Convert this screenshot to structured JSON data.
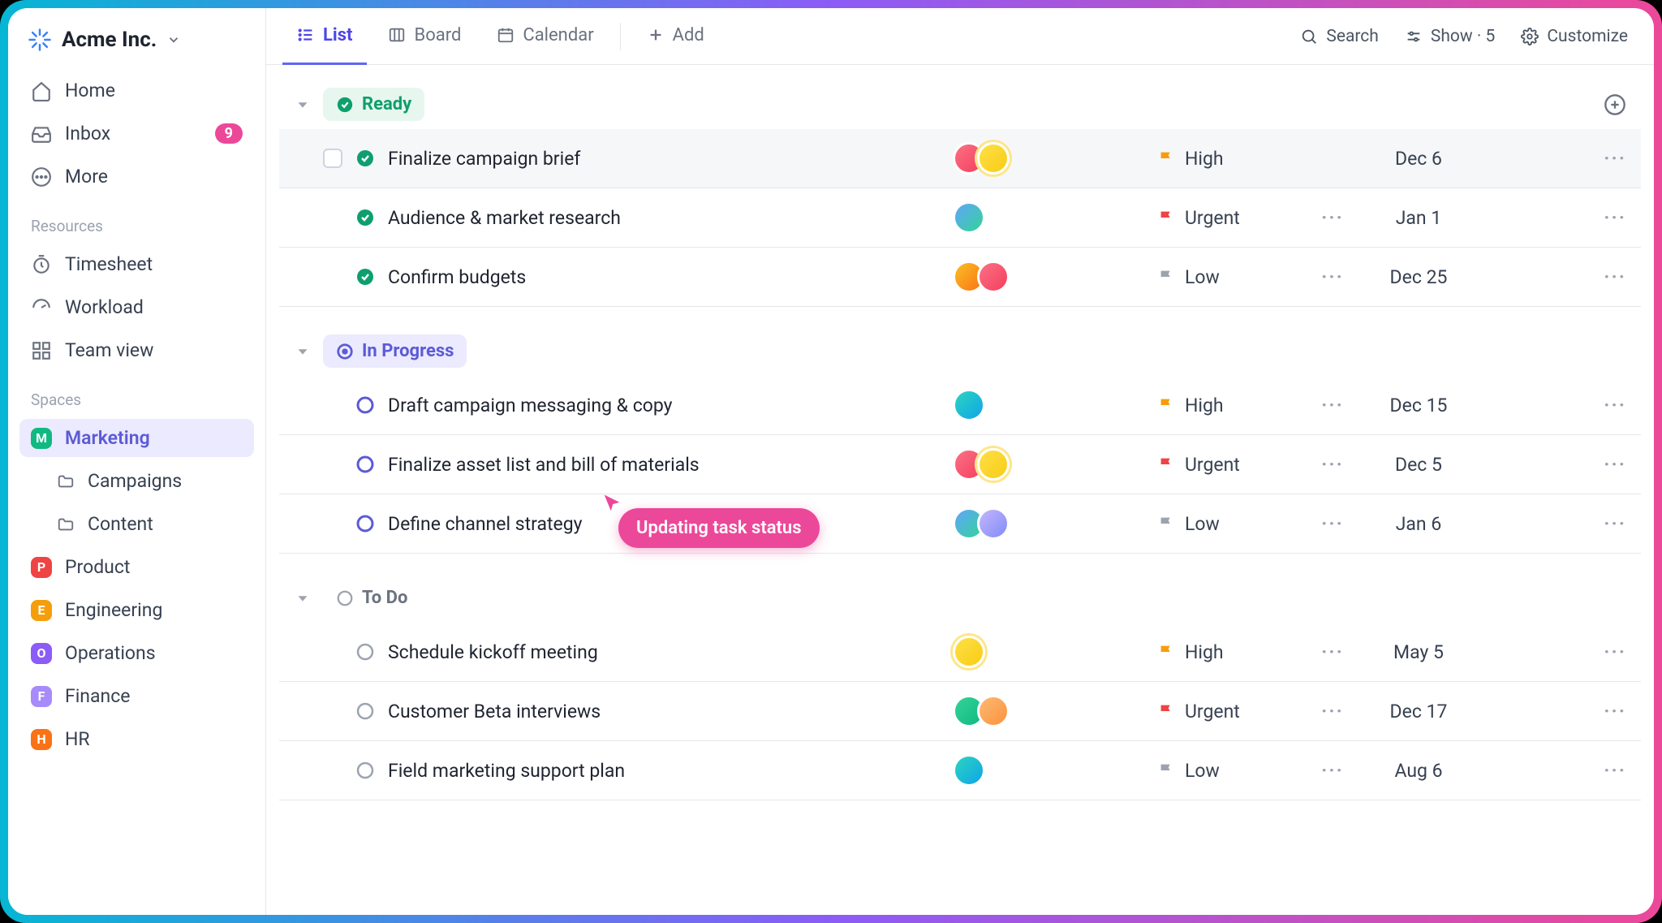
{
  "workspace": {
    "name": "Acme Inc."
  },
  "sidebar": {
    "nav": [
      {
        "label": "Home"
      },
      {
        "label": "Inbox",
        "badge": "9"
      },
      {
        "label": "More"
      }
    ],
    "section_resources": "Resources",
    "resources": [
      {
        "label": "Timesheet"
      },
      {
        "label": "Workload"
      },
      {
        "label": "Team view"
      }
    ],
    "section_spaces": "Spaces",
    "spaces": [
      {
        "letter": "M",
        "label": "Marketing",
        "color": "#10b981",
        "selected": true
      },
      {
        "letter": "P",
        "label": "Product",
        "color": "#ef4444"
      },
      {
        "letter": "E",
        "label": "Engineering",
        "color": "#f59e0b"
      },
      {
        "letter": "O",
        "label": "Operations",
        "color": "#8b5cf6"
      },
      {
        "letter": "F",
        "label": "Finance",
        "color": "#a78bfa"
      },
      {
        "letter": "H",
        "label": "HR",
        "color": "#f97316"
      }
    ],
    "marketing_children": [
      {
        "label": "Campaigns"
      },
      {
        "label": "Content"
      }
    ]
  },
  "topbar": {
    "tabs": {
      "list": "List",
      "board": "Board",
      "calendar": "Calendar",
      "add": "Add"
    },
    "tools": {
      "search": "Search",
      "show": "Show · 5",
      "customize": "Customize"
    }
  },
  "groups": {
    "ready": {
      "label": "Ready"
    },
    "in_progress": {
      "label": "In Progress"
    },
    "todo": {
      "label": "To Do"
    }
  },
  "tasks": {
    "ready": [
      {
        "name": "Finalize campaign brief",
        "avatars": [
          "a6",
          "a8"
        ],
        "ring": true,
        "priority": "High",
        "pclass": "high",
        "date": "Dec 6",
        "has_checkbox": true
      },
      {
        "name": "Audience & market research",
        "avatars": [
          "a2"
        ],
        "priority": "Urgent",
        "pclass": "urgent",
        "date": "Jan 1",
        "dots": true
      },
      {
        "name": "Confirm budgets",
        "avatars": [
          "a4",
          "a6"
        ],
        "priority": "Low",
        "pclass": "low",
        "date": "Dec 25",
        "dots": true
      }
    ],
    "in_progress": [
      {
        "name": "Draft campaign messaging & copy",
        "avatars": [
          "a9"
        ],
        "priority": "High",
        "pclass": "high",
        "date": "Dec 15",
        "dots": true
      },
      {
        "name": "Finalize asset list and bill of materials",
        "avatars": [
          "a6",
          "a8"
        ],
        "ring": true,
        "priority": "Urgent",
        "pclass": "urgent",
        "date": "Dec 5",
        "dots": true
      },
      {
        "name": "Define channel strategy",
        "avatars": [
          "a2",
          "a7"
        ],
        "priority": "Low",
        "pclass": "low",
        "date": "Jan 6",
        "dots": true
      }
    ],
    "todo": [
      {
        "name": "Schedule kickoff meeting",
        "avatars": [
          "a8"
        ],
        "ring": true,
        "priority": "High",
        "pclass": "high",
        "date": "May 5",
        "dots": true
      },
      {
        "name": "Customer Beta interviews",
        "avatars": [
          "a5",
          "a10"
        ],
        "priority": "Urgent",
        "pclass": "urgent",
        "date": "Dec 17",
        "dots": true
      },
      {
        "name": "Field marketing support plan",
        "avatars": [
          "a9"
        ],
        "priority": "Low",
        "pclass": "low",
        "date": "Aug 6",
        "dots": true
      }
    ]
  },
  "tooltip": {
    "text": "Updating task status"
  }
}
